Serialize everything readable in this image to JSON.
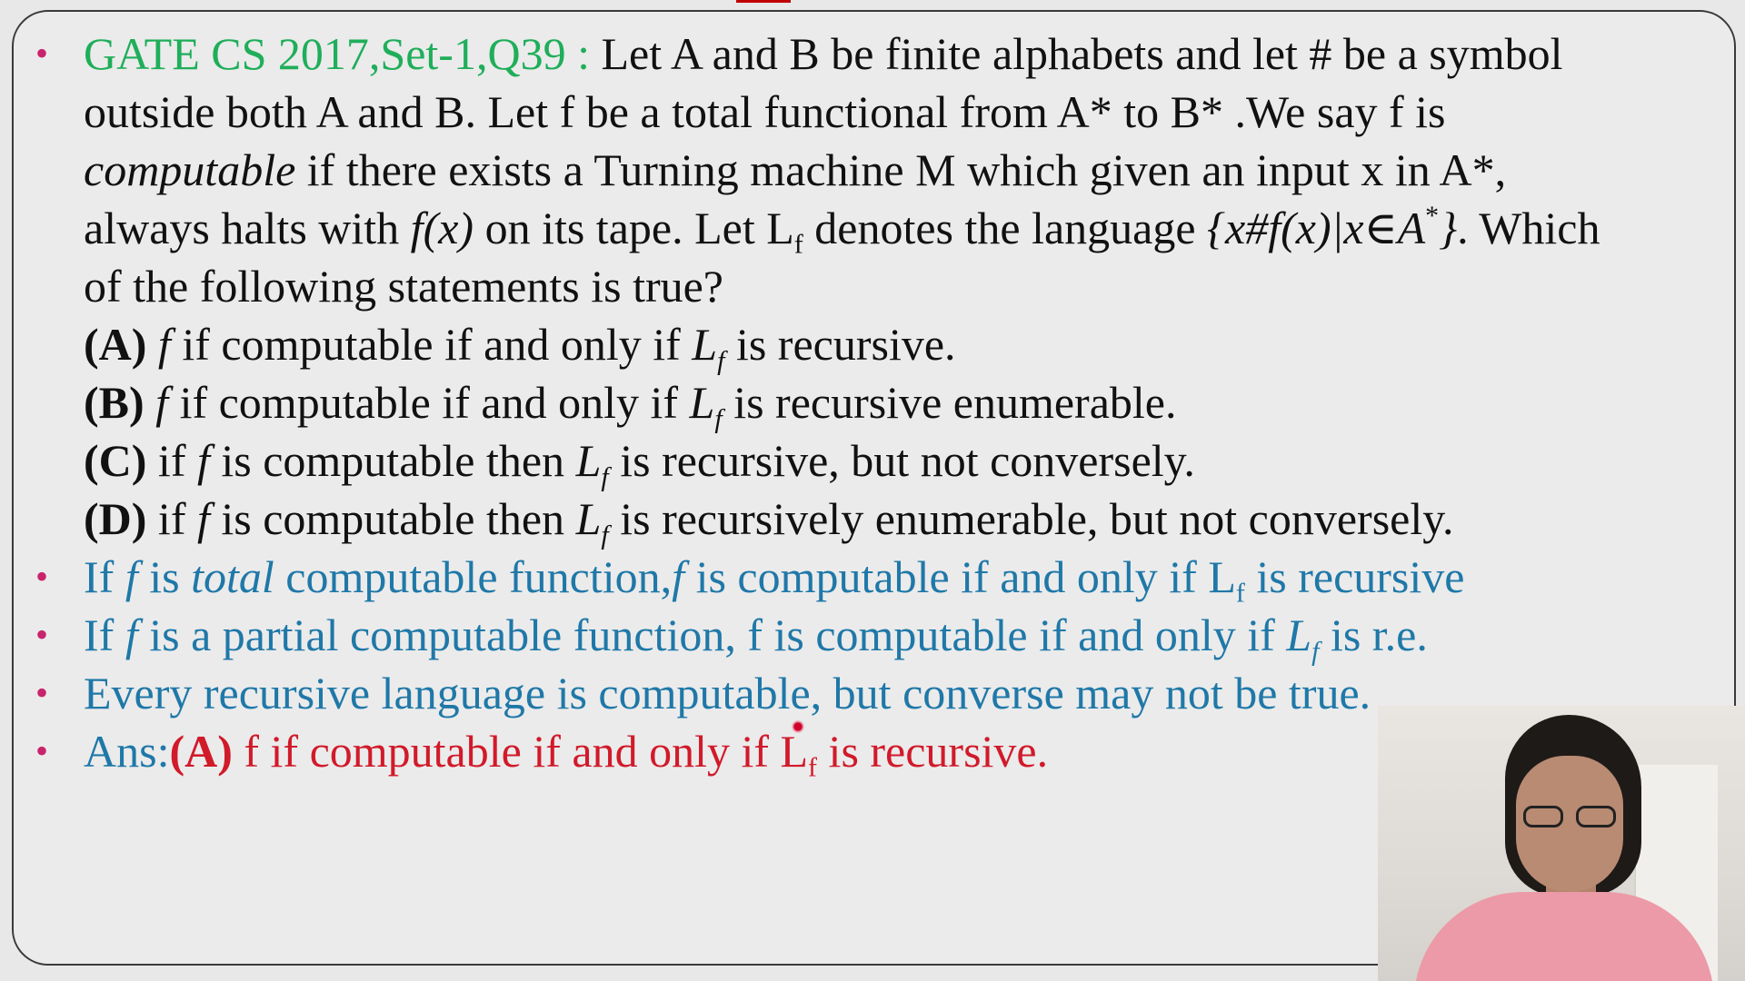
{
  "question": {
    "source": "GATE CS 2017,Set-1,Q39 :",
    "line1_rest": " Let A and B be finite alphabets and let # be a symbol",
    "line2": "outside both A and B. Let f be a total functional from A* to B* .We say f is",
    "line3_italic": "computable",
    "line3_rest": " if there exists a Turning machine M which given an input x in A*,",
    "line4_a": "always halts with ",
    "line4_fx": "f(x)",
    "line4_b": " on its tape. Let L",
    "line4_sub": "f",
    "line4_c": " denotes the language ",
    "line4_set_a": "{x#f(x)|x",
    "line4_in": "∈",
    "line4_set_b": "A",
    "line4_sup": "*",
    "line4_set_c": "}",
    "line4_d": ". Which",
    "line5": "of the following statements is true?"
  },
  "options": [
    {
      "label": "(A)",
      "pre": " ",
      "f": "f",
      "mid": " if computable if and only if ",
      "L": "L",
      "sub": "f",
      "post": " is recursive."
    },
    {
      "label": "(B)",
      "pre": " ",
      "f": "f",
      "mid": " if computable if and only if ",
      "L": "L",
      "sub": "f",
      "post": " is recursive enumerable."
    },
    {
      "label": "(C)",
      "pre": " if ",
      "f": "f",
      "mid": " is computable then ",
      "L": "L",
      "sub": "f",
      "post": " is recursive, but not conversely."
    },
    {
      "label": "(D)",
      "pre": " if ",
      "f": "f",
      "mid": " is computable then ",
      "L": "L",
      "sub": "f",
      "post": " is recursively enumerable, but not conversely."
    }
  ],
  "notes": {
    "n1_a": "If ",
    "n1_f": "f",
    "n1_b": " is ",
    "n1_total": "total",
    "n1_c": " computable function,",
    "n1_f2": "f",
    "n1_d": " is computable if and only if L",
    "n1_sub": "f",
    "n1_e": " is recursive",
    "n2_a": "If ",
    "n2_f": "f",
    "n2_b": " is a partial computable function, f is computable if and only if ",
    "n2_L": "L",
    "n2_sub": "f",
    "n2_c": " is r.e.",
    "n3": "Every recursive language is computable, but converse may not be true.",
    "ans_label": "Ans:",
    "ans_opt": "(A)",
    "ans_a": " f if computable if and only if L",
    "ans_sub": "f",
    "ans_b": " is recursive."
  },
  "bullet_glyph": "•",
  "colors": {
    "green": "#1fae5a",
    "blue": "#1f78a8",
    "red": "#d11a2a",
    "bullet": "#c8246c"
  }
}
